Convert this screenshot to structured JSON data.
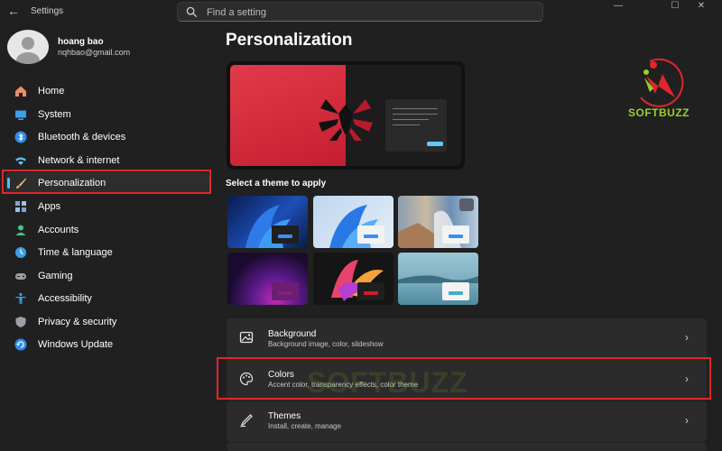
{
  "window": {
    "title": "Settings",
    "controls": {
      "minimize": "—",
      "maximize": "☐",
      "close": "✕"
    }
  },
  "search": {
    "placeholder": "Find a setting"
  },
  "profile": {
    "name": "hoang bao",
    "email": "nqhbao@gmail.com"
  },
  "sidebar": {
    "items": [
      {
        "label": "Home",
        "icon": "home-icon",
        "color": "#e98e6a"
      },
      {
        "label": "System",
        "icon": "system-icon",
        "color": "#3aa0e8"
      },
      {
        "label": "Bluetooth & devices",
        "icon": "bluetooth-icon",
        "color": "#2f8cf0"
      },
      {
        "label": "Network & internet",
        "icon": "network-icon",
        "color": "#5fc2f7"
      },
      {
        "label": "Personalization",
        "icon": "brush-icon",
        "color": "#e9a85a",
        "active": true
      },
      {
        "label": "Apps",
        "icon": "apps-icon",
        "color": "#7aa7d8"
      },
      {
        "label": "Accounts",
        "icon": "accounts-icon",
        "color": "#3fc58b"
      },
      {
        "label": "Time & language",
        "icon": "time-language-icon",
        "color": "#3aa0e8"
      },
      {
        "label": "Gaming",
        "icon": "gaming-icon",
        "color": "#9aa0a6"
      },
      {
        "label": "Accessibility",
        "icon": "accessibility-icon",
        "color": "#3aa0e8"
      },
      {
        "label": "Privacy & security",
        "icon": "shield-icon",
        "color": "#9aa0a6"
      },
      {
        "label": "Windows Update",
        "icon": "update-icon",
        "color": "#2f8cf0"
      }
    ]
  },
  "main": {
    "title": "Personalization",
    "select_theme": "Select a theme to apply",
    "logo_text": "SOFTBUZZ",
    "watermark": "SOFTBUZZ",
    "themes": [
      {
        "name": "windows-dark-theme"
      },
      {
        "name": "windows-light-theme"
      },
      {
        "name": "spotlight-theme"
      },
      {
        "name": "glow-theme"
      },
      {
        "name": "captured-motion-theme"
      },
      {
        "name": "flow-theme"
      }
    ],
    "cards": [
      {
        "title": "Background",
        "subtitle": "Background image, color, slideshow",
        "icon": "image-icon"
      },
      {
        "title": "Colors",
        "subtitle": "Accent color, transparency effects, color theme",
        "icon": "palette-icon"
      },
      {
        "title": "Themes",
        "subtitle": "Install, create, manage",
        "icon": "pen-icon"
      }
    ]
  },
  "colors": {
    "accent": "#4cc2ff",
    "highlight": "#e0262d",
    "background": "#202020",
    "card": "#2b2b2b"
  }
}
